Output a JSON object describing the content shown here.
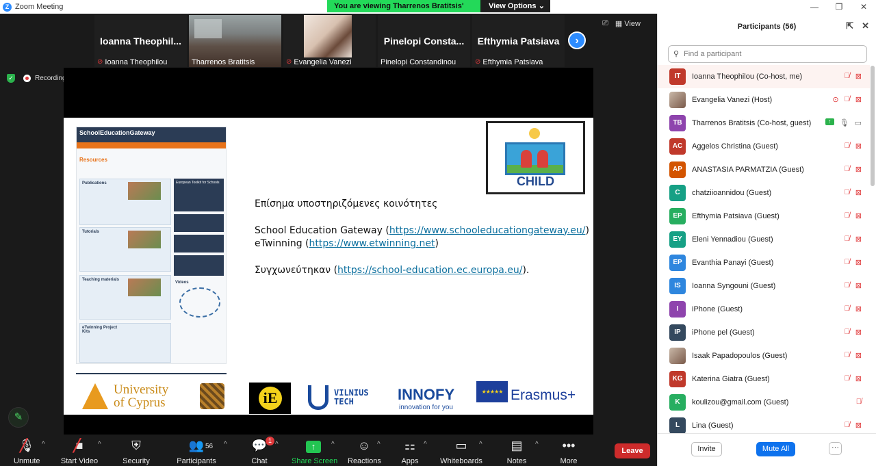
{
  "window": {
    "title": "Zoom Meeting",
    "minimize": "—",
    "maximize": "❐",
    "close": "✕"
  },
  "share_banner": {
    "viewing": "You are viewing Tharrenos Bratitsis' screen",
    "view_options": "View Options",
    "caret": "⌄"
  },
  "top_right": {
    "view_label": "View"
  },
  "recording": {
    "label": "Recording"
  },
  "video_strip": [
    {
      "big_name": "Ioanna  Theophil...",
      "label": "Ioanna Theophilou",
      "muted": true,
      "active": false,
      "photo": ""
    },
    {
      "big_name": "",
      "label": "Tharrenos Bratitsis",
      "muted": false,
      "active": true,
      "photo": "classroom"
    },
    {
      "big_name": "",
      "label": "Evangelia Vanezi",
      "muted": true,
      "active": false,
      "photo": "person"
    },
    {
      "big_name": "Pinelopi  Consta...",
      "label": "Pinelopi Constandinou",
      "muted": false,
      "active": false,
      "photo": ""
    },
    {
      "big_name": "Efthymia Patsiava",
      "label": "Efthymia Patsiava",
      "muted": true,
      "active": false,
      "photo": ""
    }
  ],
  "slide": {
    "seg": {
      "title": "SchoolEducationGateway",
      "section": "Resources",
      "cards": [
        {
          "heading": "Publications"
        },
        {
          "heading": "Tutorials"
        },
        {
          "heading": "Teaching materials"
        },
        {
          "heading": "eTwinning Project Kits"
        }
      ],
      "side": [
        "European Toolkit for Schools",
        "",
        "",
        ""
      ],
      "videos_label": "Videos"
    },
    "child_logo": "CHILD",
    "line1": "Επίσημα υποστηριζόμενες κοινότητες",
    "seg_prefix": "School Education Gateway (",
    "seg_url": "https://www.schooleducationgateway.eu/",
    "seg_suffix": ")",
    "etw_prefix": "eTwinning (",
    "etw_url": "https://www.etwinning.net",
    "etw_suffix": ")",
    "merged_prefix": "Συγχωνεύτηκαν (",
    "merged_url": "https://school-education.ec.europa.eu/",
    "merged_suffix": ").",
    "logos": {
      "ucy_line1": "University",
      "ucy_line2": "of Cyprus",
      "ie": "iE",
      "vilnius_line1": "VILNIUS",
      "vilnius_line2": "TECH",
      "innofy": "INNOFY",
      "innofy_tag": "innovation for you",
      "erasmus": "Erasmus+",
      "eu_stars": "★★★★★"
    }
  },
  "toolbar": {
    "unmute": "Unmute",
    "start_video": "Start Video",
    "security": "Security",
    "participants": "Participants",
    "participants_count": "56",
    "chat": "Chat",
    "chat_badge": "1",
    "share_screen": "Share Screen",
    "reactions": "Reactions",
    "apps": "Apps",
    "whiteboards": "Whiteboards",
    "notes": "Notes",
    "more": "More",
    "leave": "Leave"
  },
  "panel": {
    "title": "Participants (56)",
    "search_placeholder": "Find a participant",
    "participants": [
      {
        "initials": "IT",
        "name": "Ioanna Theophilou (Co-host, me)",
        "color": "#c0392b",
        "photo": false,
        "mic": "off",
        "cam": "off",
        "share": false,
        "extra": ""
      },
      {
        "initials": "",
        "name": "Evangelia Vanezi (Host)",
        "color": "",
        "photo": true,
        "mic": "off",
        "cam": "off",
        "share": false,
        "extra": "rec"
      },
      {
        "initials": "TB",
        "name": "Tharrenos Bratitsis (Co-host, guest)",
        "color": "#8e44ad",
        "photo": false,
        "mic": "on",
        "cam": "on",
        "share": true,
        "extra": ""
      },
      {
        "initials": "AC",
        "name": "Aggelos Christina (Guest)",
        "color": "#c0392b",
        "photo": false,
        "mic": "off",
        "cam": "off",
        "share": false,
        "extra": ""
      },
      {
        "initials": "AP",
        "name": "ANASTASIA PARMATZIA (Guest)",
        "color": "#d35400",
        "photo": false,
        "mic": "off",
        "cam": "off",
        "share": false,
        "extra": ""
      },
      {
        "initials": "C",
        "name": "chatziioannidou (Guest)",
        "color": "#16a085",
        "photo": false,
        "mic": "off",
        "cam": "off",
        "share": false,
        "extra": ""
      },
      {
        "initials": "EP",
        "name": "Efthymia Patsiava (Guest)",
        "color": "#27ae60",
        "photo": false,
        "mic": "off",
        "cam": "off",
        "share": false,
        "extra": ""
      },
      {
        "initials": "EY",
        "name": "Eleni Yennadiou (Guest)",
        "color": "#16a085",
        "photo": false,
        "mic": "off",
        "cam": "off",
        "share": false,
        "extra": ""
      },
      {
        "initials": "EP",
        "name": "Evanthia Panayi (Guest)",
        "color": "#2e86de",
        "photo": false,
        "mic": "off",
        "cam": "off",
        "share": false,
        "extra": ""
      },
      {
        "initials": "IS",
        "name": "Ioanna Syngouni (Guest)",
        "color": "#2e86de",
        "photo": false,
        "mic": "off",
        "cam": "off",
        "share": false,
        "extra": ""
      },
      {
        "initials": "I",
        "name": "iPhone (Guest)",
        "color": "#8e44ad",
        "photo": false,
        "mic": "off",
        "cam": "off",
        "share": false,
        "extra": ""
      },
      {
        "initials": "IP",
        "name": "iPhone pel (Guest)",
        "color": "#34495e",
        "photo": false,
        "mic": "off",
        "cam": "off",
        "share": false,
        "extra": ""
      },
      {
        "initials": "",
        "name": "Isaak Papadopoulos (Guest)",
        "color": "",
        "photo": true,
        "mic": "off",
        "cam": "off",
        "share": false,
        "extra": ""
      },
      {
        "initials": "KG",
        "name": "Katerina Giatra (Guest)",
        "color": "#c0392b",
        "photo": false,
        "mic": "off",
        "cam": "off",
        "share": false,
        "extra": ""
      },
      {
        "initials": "K",
        "name": "koulizou@gmail.com (Guest)",
        "color": "#27ae60",
        "photo": false,
        "mic": "off",
        "cam": "none",
        "share": false,
        "extra": ""
      },
      {
        "initials": "L",
        "name": "Lina (Guest)",
        "color": "#34495e",
        "photo": false,
        "mic": "off",
        "cam": "off",
        "share": false,
        "extra": ""
      }
    ],
    "invite": "Invite",
    "mute_all": "Mute All",
    "more": "···"
  }
}
